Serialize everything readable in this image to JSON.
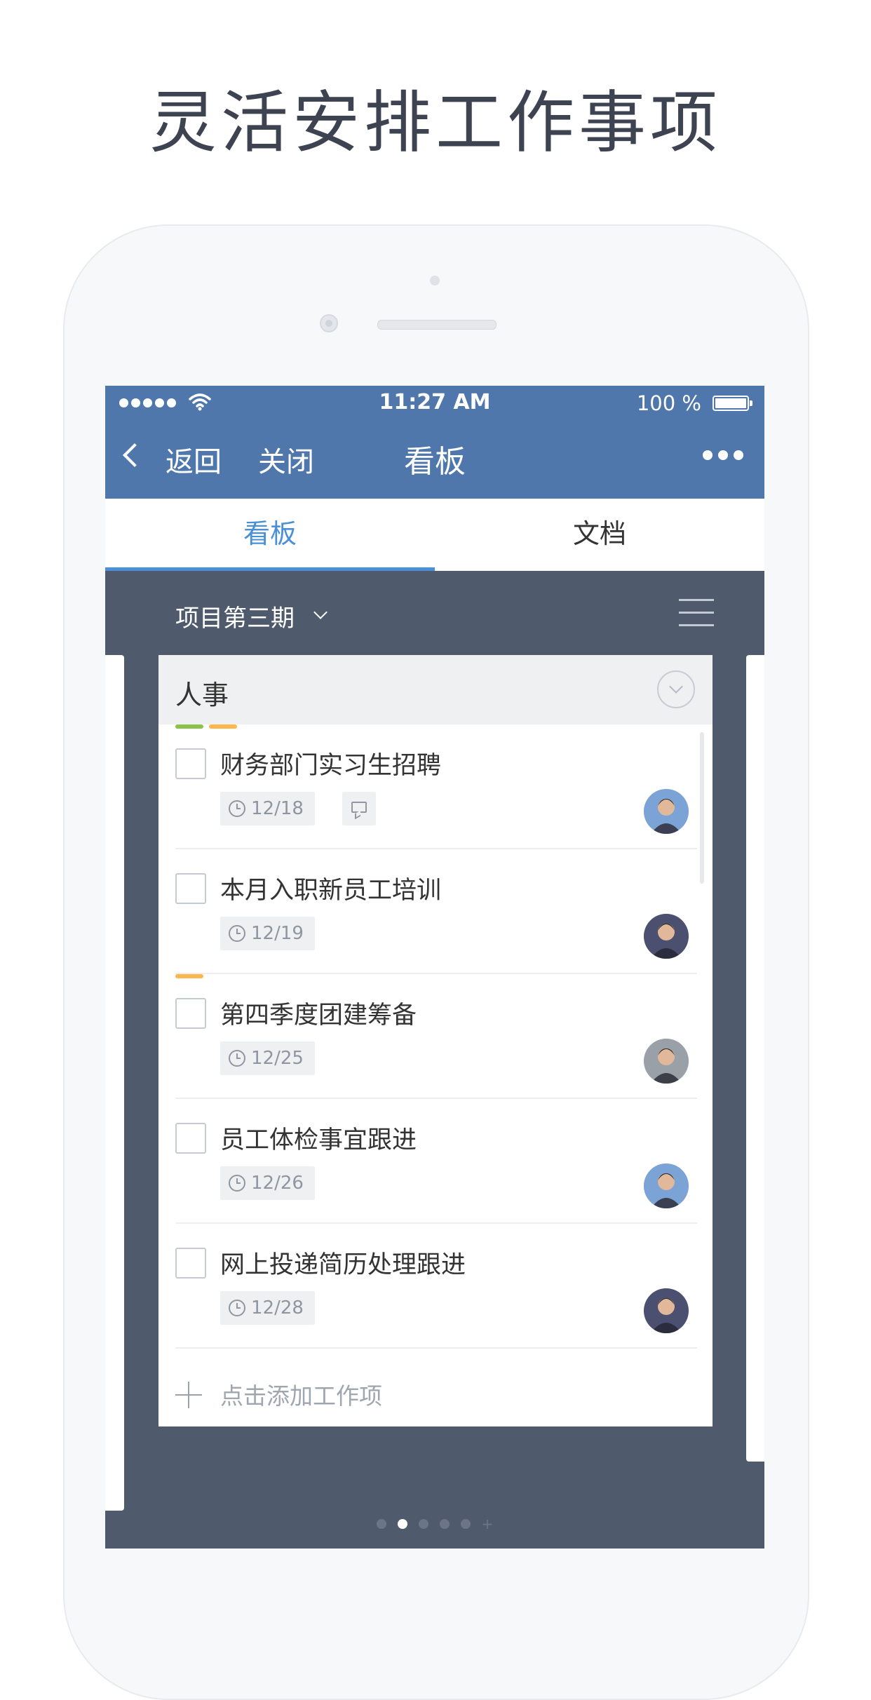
{
  "headline": "灵活安排工作事项",
  "status_bar": {
    "time": "11:27 AM",
    "battery": "100 %"
  },
  "nav": {
    "back": "返回",
    "close": "关闭",
    "title": "看板"
  },
  "tabs": [
    {
      "label": "看板",
      "active": true
    },
    {
      "label": "文档",
      "active": false
    }
  ],
  "project": {
    "name": "项目第三期"
  },
  "list": {
    "title": "人事",
    "add_label": "点击添加工作项",
    "tasks": [
      {
        "title": "财务部门实习生招聘",
        "due": "12/18",
        "has_comment": true,
        "tags": [
          "#8bc34a",
          "#ffb74d"
        ]
      },
      {
        "title": "本月入职新员工培训",
        "due": "12/19",
        "has_comment": false,
        "tags": []
      },
      {
        "title": "第四季度团建筹备",
        "due": "12/25",
        "has_comment": false,
        "tags": [
          "#ffb74d"
        ]
      },
      {
        "title": "员工体检事宜跟进",
        "due": "12/26",
        "has_comment": false,
        "tags": []
      },
      {
        "title": "网上投递简历处理跟进",
        "due": "12/28",
        "has_comment": false,
        "tags": []
      }
    ]
  },
  "pager": {
    "count": 5,
    "active": 1
  },
  "colors": {
    "accent": "#4a90d9",
    "navbar": "#4f77ab",
    "board_bg": "#4f5b6c",
    "tag_green": "#8bc34a",
    "tag_orange": "#ffb74d"
  }
}
